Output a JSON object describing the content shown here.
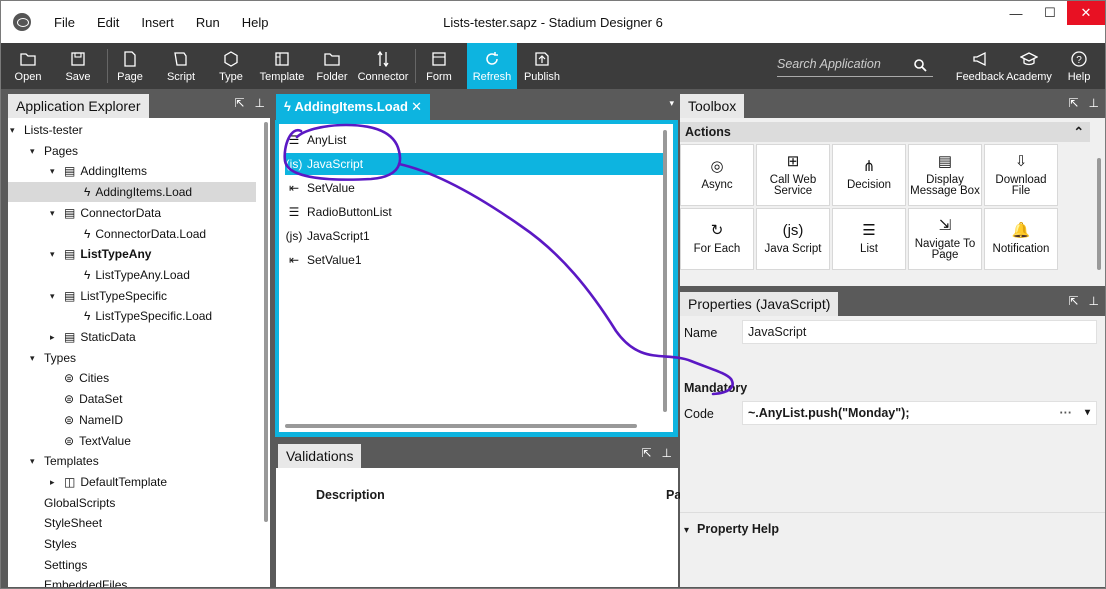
{
  "window": {
    "title": "Lists-tester.sapz - Stadium Designer 6",
    "menu": [
      "File",
      "Edit",
      "Insert",
      "Run",
      "Help"
    ],
    "controls": {
      "minimize": "—",
      "maximize": "☐",
      "close": "✕"
    }
  },
  "toolbar": {
    "buttons": [
      {
        "label": "Open",
        "icon": "folder-open-icon"
      },
      {
        "label": "Save",
        "icon": "save-icon"
      },
      {
        "label": "Page",
        "icon": "page-icon"
      },
      {
        "label": "Script",
        "icon": "script-icon"
      },
      {
        "label": "Type",
        "icon": "type-icon"
      },
      {
        "label": "Template",
        "icon": "template-icon"
      },
      {
        "label": "Folder",
        "icon": "folder-icon"
      },
      {
        "label": "Connector",
        "icon": "connector-icon"
      },
      {
        "label": "Form",
        "icon": "form-icon"
      },
      {
        "label": "Refresh",
        "icon": "refresh-icon"
      },
      {
        "label": "Publish",
        "icon": "publish-icon"
      }
    ],
    "search_placeholder": "Search Application",
    "right_buttons": [
      {
        "label": "Feedback",
        "icon": "megaphone-icon"
      },
      {
        "label": "Academy",
        "icon": "graduation-cap-icon"
      },
      {
        "label": "Help",
        "icon": "help-icon"
      }
    ],
    "active_color": "#0db4e0"
  },
  "explorer": {
    "title": "Application Explorer",
    "tree": [
      {
        "label": "Lists-tester",
        "depth": 0,
        "arrow": "▾",
        "icon": ""
      },
      {
        "label": "Pages",
        "depth": 1,
        "arrow": "▾",
        "icon": ""
      },
      {
        "label": "AddingItems",
        "depth": 2,
        "arrow": "▾",
        "icon": "page-icon"
      },
      {
        "label": "AddingItems.Load",
        "depth": 3,
        "arrow": "",
        "icon": "bolt-icon",
        "selected": true
      },
      {
        "label": "ConnectorData",
        "depth": 2,
        "arrow": "▾",
        "icon": "page-icon"
      },
      {
        "label": "ConnectorData.Load",
        "depth": 3,
        "arrow": "",
        "icon": "bolt-icon"
      },
      {
        "label": "ListTypeAny",
        "depth": 2,
        "arrow": "▾",
        "icon": "page-icon",
        "bold": true
      },
      {
        "label": "ListTypeAny.Load",
        "depth": 3,
        "arrow": "",
        "icon": "bolt-icon"
      },
      {
        "label": "ListTypeSpecific",
        "depth": 2,
        "arrow": "▾",
        "icon": "page-icon"
      },
      {
        "label": "ListTypeSpecific.Load",
        "depth": 3,
        "arrow": "",
        "icon": "bolt-icon"
      },
      {
        "label": "StaticData",
        "depth": 2,
        "arrow": "▸",
        "icon": "page-icon"
      },
      {
        "label": "Types",
        "depth": 1,
        "arrow": "▾",
        "icon": ""
      },
      {
        "label": "Cities",
        "depth": 2,
        "arrow": "",
        "icon": "type-icon"
      },
      {
        "label": "DataSet",
        "depth": 2,
        "arrow": "",
        "icon": "type-icon"
      },
      {
        "label": "NameID",
        "depth": 2,
        "arrow": "",
        "icon": "type-icon"
      },
      {
        "label": "TextValue",
        "depth": 2,
        "arrow": "",
        "icon": "type-icon"
      },
      {
        "label": "Templates",
        "depth": 1,
        "arrow": "▾",
        "icon": ""
      },
      {
        "label": "DefaultTemplate",
        "depth": 2,
        "arrow": "▸",
        "icon": "template-icon"
      },
      {
        "label": "GlobalScripts",
        "depth": 1,
        "arrow": "",
        "icon": ""
      },
      {
        "label": "StyleSheet",
        "depth": 1,
        "arrow": "",
        "icon": ""
      },
      {
        "label": "Styles",
        "depth": 1,
        "arrow": "",
        "icon": ""
      },
      {
        "label": "Settings",
        "depth": 1,
        "arrow": "",
        "icon": ""
      },
      {
        "label": "EmbeddedFiles",
        "depth": 1,
        "arrow": "",
        "icon": ""
      }
    ]
  },
  "editor": {
    "tab_label": "AddingItems.Load",
    "tab_close": "✕",
    "actions": [
      {
        "label": "AnyList",
        "icon": "list-icon",
        "glyph": "☰"
      },
      {
        "label": "JavaScript",
        "icon": "js-icon",
        "glyph": "(js)",
        "selected": true
      },
      {
        "label": "SetValue",
        "icon": "set-value-icon",
        "glyph": "⇤"
      },
      {
        "label": "RadioButtonList",
        "icon": "list-icon",
        "glyph": "☰"
      },
      {
        "label": "JavaScript1",
        "icon": "js-icon",
        "glyph": "(js)"
      },
      {
        "label": "SetValue1",
        "icon": "set-value-icon",
        "glyph": "⇤"
      }
    ]
  },
  "validations": {
    "title": "Validations",
    "col_description": "Description",
    "col_second": "Pa"
  },
  "toolbox": {
    "title": "Toolbox",
    "section": "Actions",
    "tiles": [
      {
        "label": "Async",
        "icon": "async-icon",
        "glyph": "◎"
      },
      {
        "label": "Call Web Service",
        "icon": "web-service-icon",
        "glyph": "⊞"
      },
      {
        "label": "Decision",
        "icon": "decision-icon",
        "glyph": "⋔"
      },
      {
        "label": "Display Message Box",
        "icon": "message-box-icon",
        "glyph": "▤"
      },
      {
        "label": "Download File",
        "icon": "download-icon",
        "glyph": "⇩"
      },
      {
        "label": "For Each",
        "icon": "for-each-icon",
        "glyph": "↻"
      },
      {
        "label": "Java Script",
        "icon": "js-icon",
        "glyph": "(js)"
      },
      {
        "label": "List",
        "icon": "list-icon",
        "glyph": "☰"
      },
      {
        "label": "Navigate To Page",
        "icon": "navigate-icon",
        "glyph": "⇲"
      },
      {
        "label": "Notification",
        "icon": "bell-icon",
        "glyph": "🔔"
      }
    ]
  },
  "properties": {
    "title": "Properties (JavaScript)",
    "name_label": "Name",
    "name_value": "JavaScript",
    "mandatory_label": "Mandatory",
    "code_label": "Code",
    "code_value": "~.AnyList.push(\"Monday\");",
    "code_more": "···",
    "property_help": "Property Help"
  },
  "annotation_color": "#5b18c4"
}
